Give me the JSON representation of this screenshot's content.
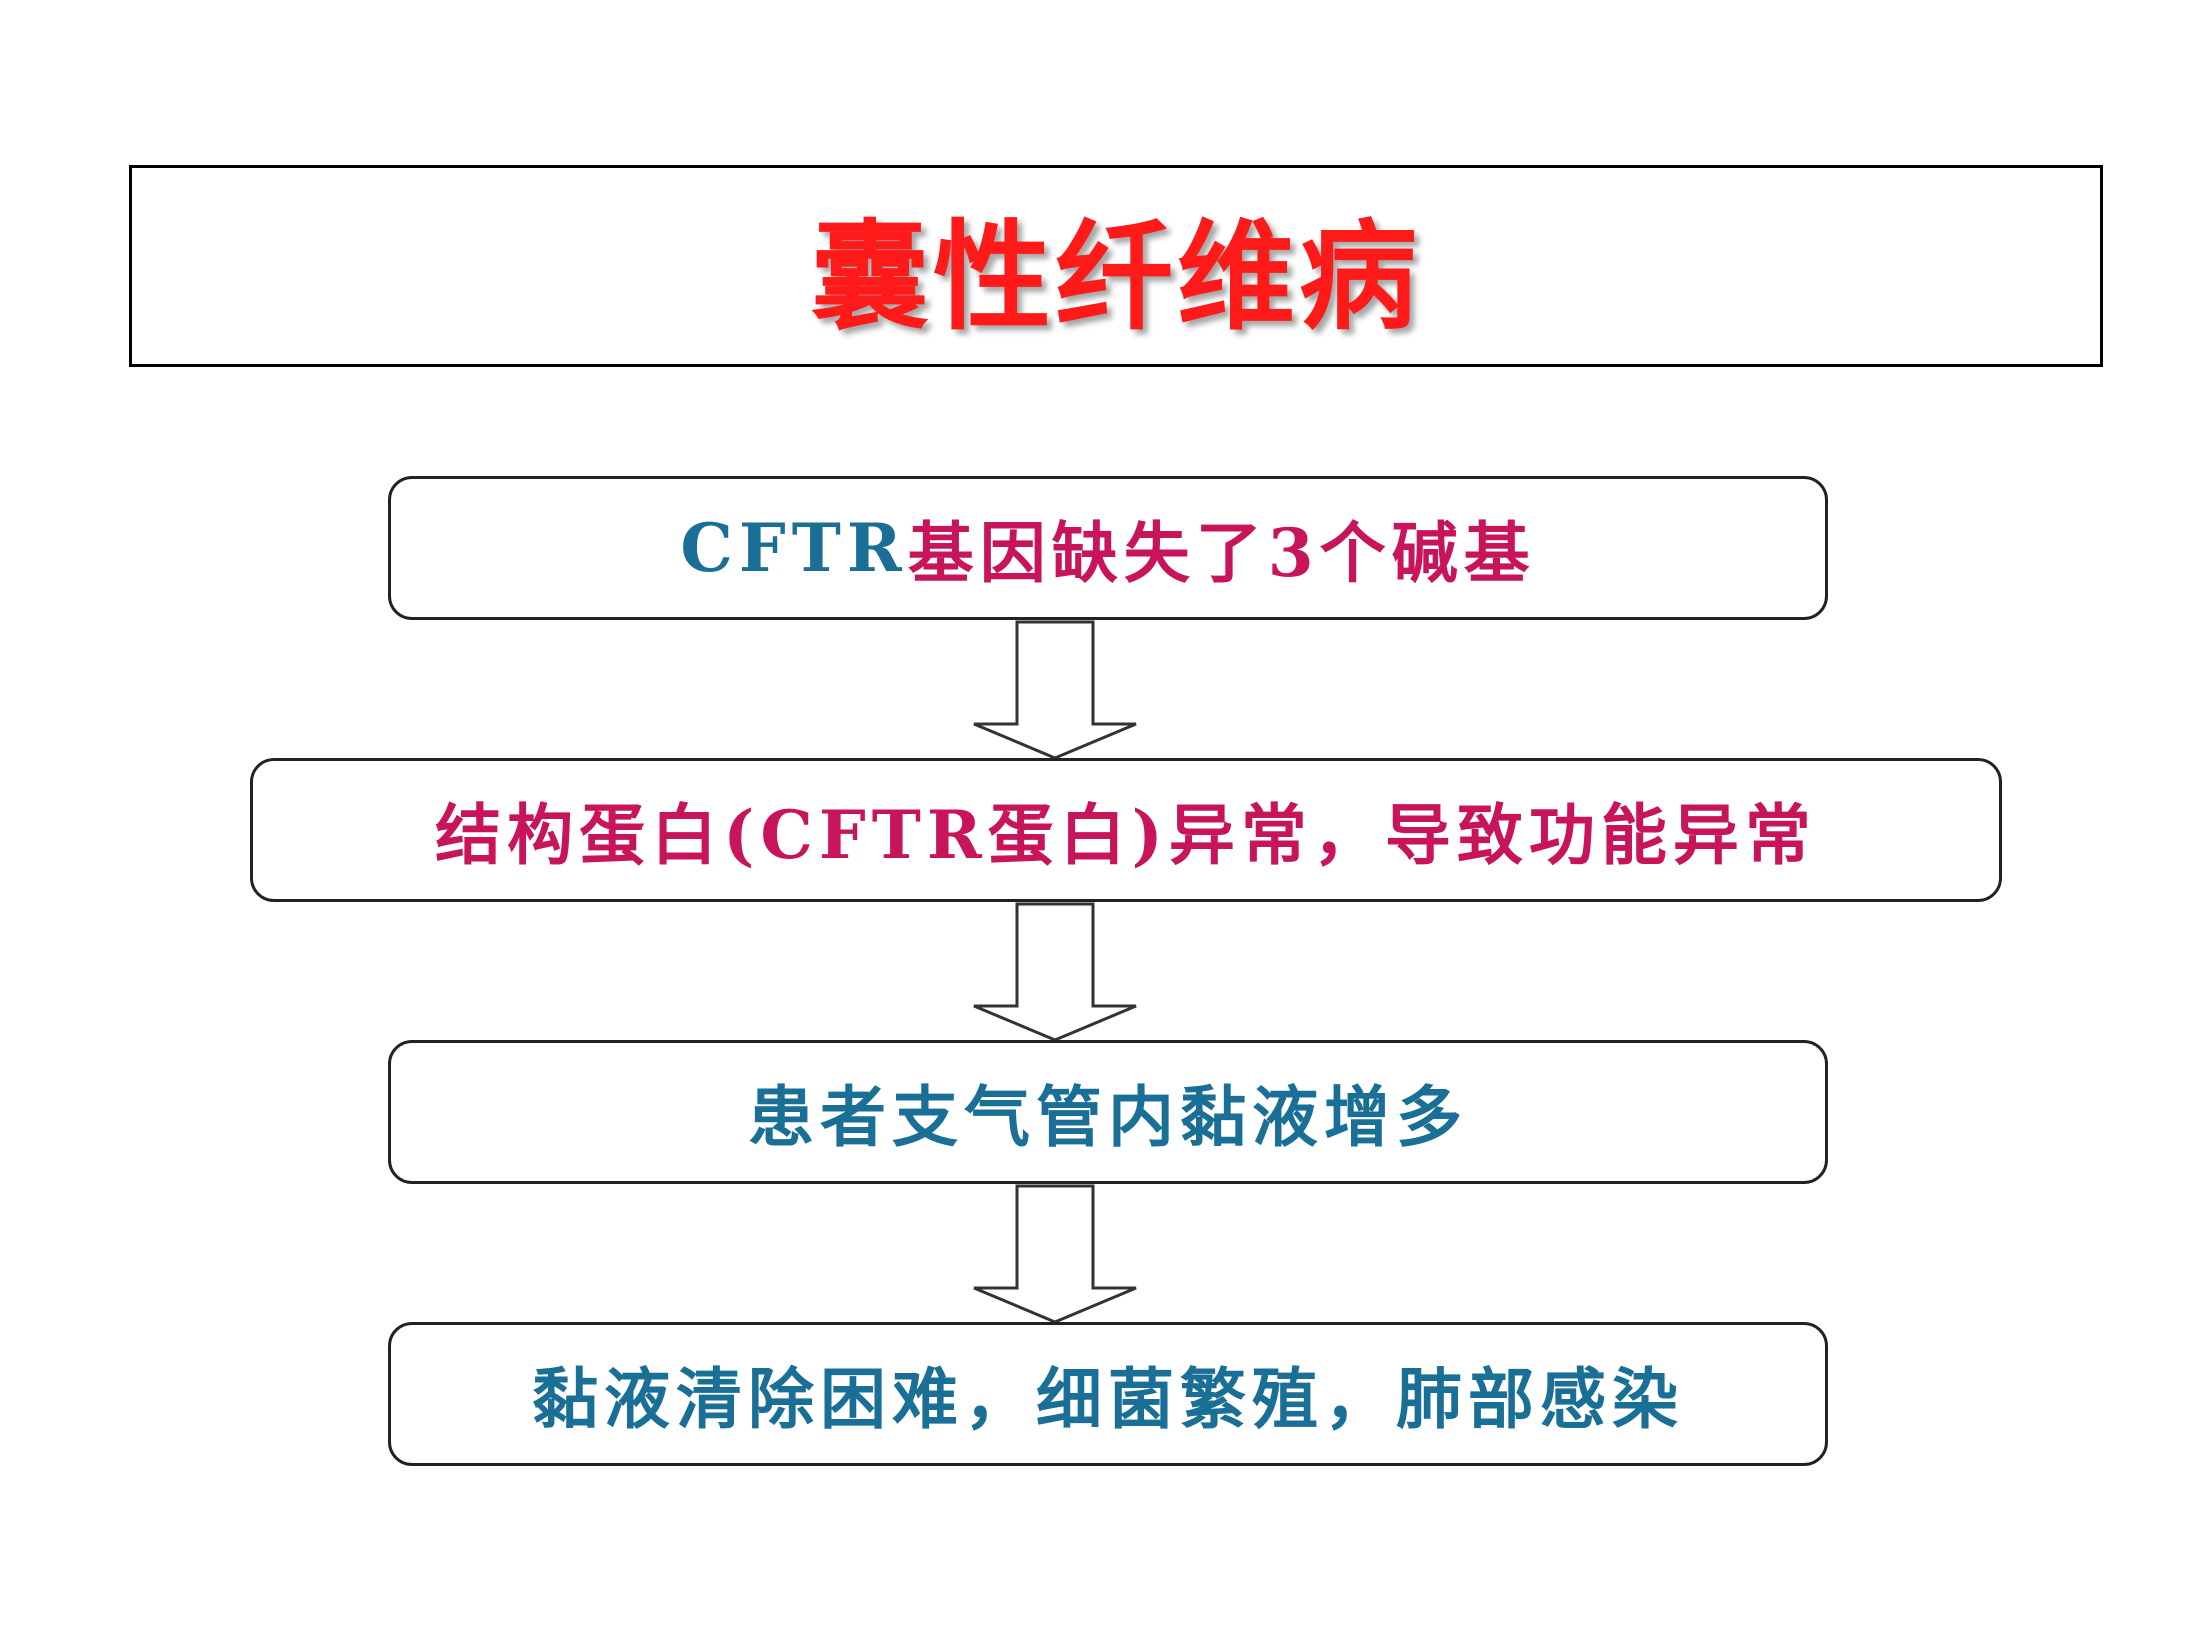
{
  "title": {
    "text": "囊性纤维病",
    "color": "#ff1a1a"
  },
  "steps": [
    {
      "parts": [
        {
          "text": "CFTR",
          "color": "#1a6f96"
        },
        {
          "text": "基因缺失了3个碱基",
          "color": "#c8145a"
        }
      ]
    },
    {
      "parts": [
        {
          "text": "结构蛋白(CFTR蛋白)异常，导致功能异常",
          "color": "#c8145a"
        }
      ]
    },
    {
      "parts": [
        {
          "text": "患者支气管内黏液增多",
          "color": "#1a6f96"
        }
      ]
    },
    {
      "parts": [
        {
          "text": "黏液清除困难，细菌繁殖，肺部感染",
          "color": "#1a6f96"
        }
      ]
    }
  ],
  "arrow_icon": "down-arrow-icon"
}
